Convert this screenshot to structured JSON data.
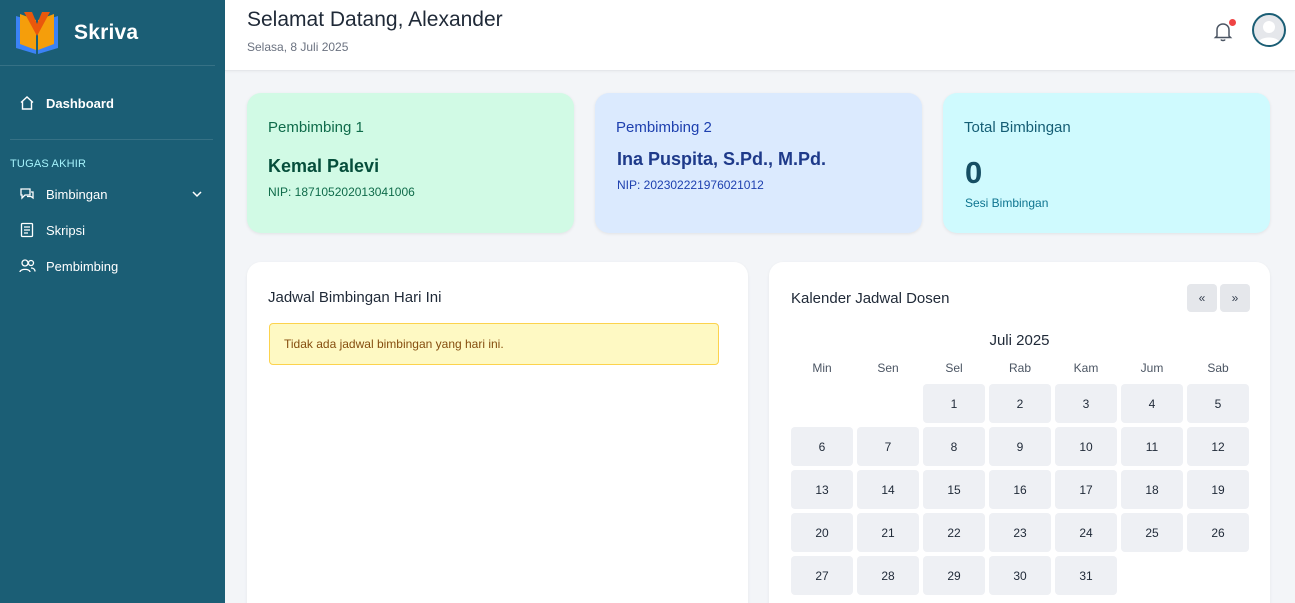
{
  "sidebar": {
    "brand": "Skriva",
    "dashboard": "Dashboard",
    "section_label": "TUGAS AKHIR",
    "items": [
      {
        "label": "Bimbingan",
        "icon": "chat-icon"
      },
      {
        "label": "Skripsi",
        "icon": "document-icon"
      },
      {
        "label": "Pembimbing",
        "icon": "users-icon"
      }
    ]
  },
  "header": {
    "greeting": "Selamat Datang, Alexander",
    "date": "Selasa, 8 Juli 2025"
  },
  "cards": {
    "pembimbing1": {
      "title": "Pembimbing 1",
      "name": "Kemal Palevi",
      "nip": "NIP: 187105202013041006"
    },
    "pembimbing2": {
      "title": "Pembimbing 2",
      "name": "Ina Puspita, S.Pd., M.Pd.",
      "nip": "NIP: 202302221976021012"
    },
    "total": {
      "title": "Total Bimbingan",
      "value": "0",
      "sub": "Sesi Bimbingan"
    }
  },
  "schedule": {
    "title": "Jadwal Bimbingan Hari Ini",
    "empty_message": "Tidak ada jadwal bimbingan yang hari ini."
  },
  "calendar": {
    "title": "Kalender Jadwal Dosen",
    "prev_label": "«",
    "next_label": "»",
    "month_label": "Juli 2025",
    "weekdays": [
      "Min",
      "Sen",
      "Sel",
      "Rab",
      "Kam",
      "Jum",
      "Sab"
    ],
    "leading_blanks": 2,
    "days": [
      "1",
      "2",
      "3",
      "4",
      "5",
      "6",
      "7",
      "8",
      "9",
      "10",
      "11",
      "12",
      "13",
      "14",
      "15",
      "16",
      "17",
      "18",
      "19",
      "20",
      "21",
      "22",
      "23",
      "24",
      "25",
      "26",
      "27",
      "28",
      "29",
      "30",
      "31"
    ]
  },
  "colors": {
    "sidebar_bg": "#1b5e75",
    "card_green": "#d1fae5",
    "card_blue": "#dbeafe",
    "card_cyan": "#cffafe",
    "notification_dot": "#ef4444"
  }
}
